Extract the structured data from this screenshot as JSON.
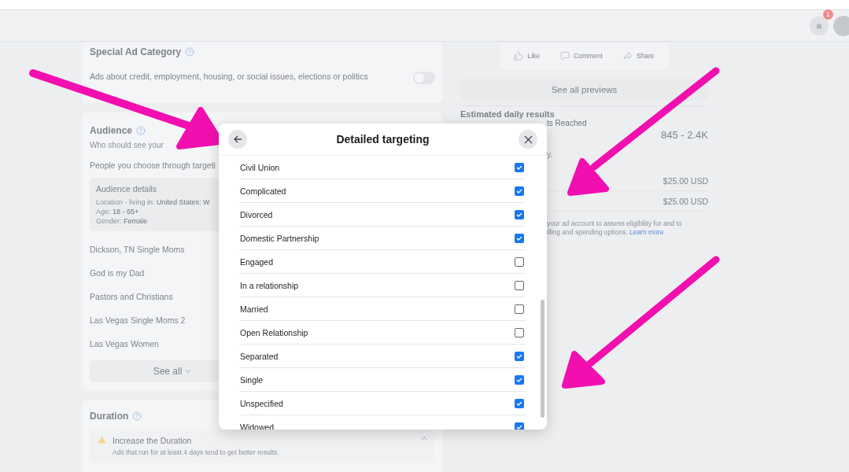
{
  "top_bar": {
    "notification_count": "1"
  },
  "special_ad_category": {
    "title": "Special Ad Category",
    "description": "Ads about credit, employment, housing, or social issues, elections or politics",
    "on": false
  },
  "audience": {
    "title": "Audience",
    "subtitle": "Who should see your",
    "choice": "People you choose through targeti",
    "details": {
      "title": "Audience details",
      "lines": [
        {
          "label": "Location - living in:",
          "value": "United States: W"
        },
        {
          "label": "Age:",
          "value": "18 - 65+"
        },
        {
          "label": "Gender:",
          "value": "Female"
        }
      ]
    },
    "saved_audiences": [
      "Dickson, TN Single Moms",
      "God is my Dad",
      "Pastors and Christians",
      "Las Vegas Single Moms 2",
      "Las Vegas Women"
    ],
    "see_all": "See all"
  },
  "duration": {
    "title": "Duration",
    "warning_title": "Increase the Duration",
    "warning_text": "Ads that run for at least 4 days tend to get better results."
  },
  "preview": {
    "actions": [
      "Like",
      "Comment",
      "Share"
    ],
    "see_all": "See all previews"
  },
  "results": {
    "title": "Estimated daily results",
    "reach_label": "ts Reached",
    "reach_value": "845 - 2.4K",
    "fragment": "y.",
    "amounts": [
      "$25.00 USD",
      "$25.00 USD"
    ],
    "note_lines": [
      "your ad account to assess eligibility for and to",
      "illing and spending options."
    ],
    "note_link": "Learn more"
  },
  "modal": {
    "title": "Detailed targeting",
    "items": [
      {
        "label": "Civil Union",
        "checked": true
      },
      {
        "label": "Complicated",
        "checked": true
      },
      {
        "label": "Divorced",
        "checked": true
      },
      {
        "label": "Domestic Partnership",
        "checked": true
      },
      {
        "label": "Engaged",
        "checked": false
      },
      {
        "label": "In a relationship",
        "checked": false
      },
      {
        "label": "Married",
        "checked": false
      },
      {
        "label": "Open Relationship",
        "checked": false
      },
      {
        "label": "Separated",
        "checked": true
      },
      {
        "label": "Single",
        "checked": true
      },
      {
        "label": "Unspecified",
        "checked": true
      },
      {
        "label": "Widowed",
        "checked": true
      }
    ]
  }
}
